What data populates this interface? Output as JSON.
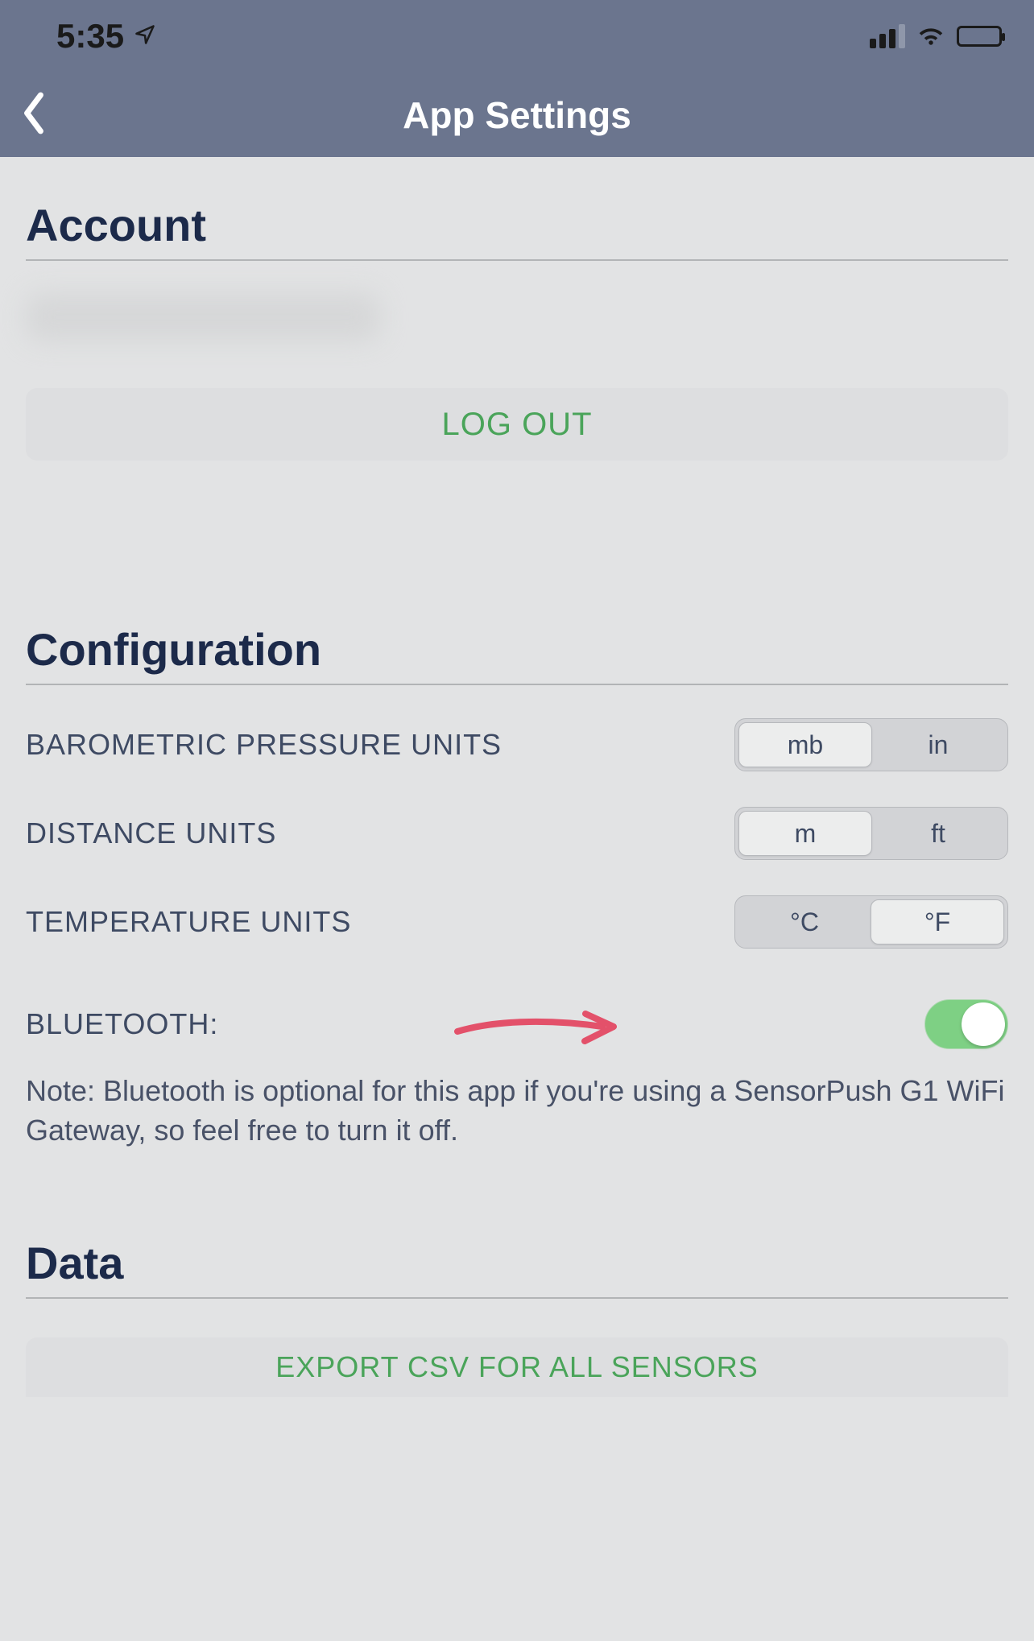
{
  "statusbar": {
    "time": "5:35"
  },
  "header": {
    "title": "App Settings"
  },
  "account": {
    "heading": "Account",
    "logout_label": "LOG OUT"
  },
  "configuration": {
    "heading": "Configuration",
    "rows": {
      "barometric": {
        "label": "BAROMETRIC PRESSURE UNITS",
        "option_a": "mb",
        "option_b": "in",
        "selected": "mb"
      },
      "distance": {
        "label": "DISTANCE UNITS",
        "option_a": "m",
        "option_b": "ft",
        "selected": "m"
      },
      "temperature": {
        "label": "TEMPERATURE UNITS",
        "option_a": "°C",
        "option_b": "°F",
        "selected": "°F"
      }
    },
    "bluetooth": {
      "label": "BLUETOOTH:",
      "enabled": true,
      "note": "Note: Bluetooth is optional for this app if you're using a SensorPush G1 WiFi Gateway, so feel free to turn it off."
    }
  },
  "data": {
    "heading": "Data",
    "export_label": "EXPORT CSV FOR ALL SENSORS"
  }
}
